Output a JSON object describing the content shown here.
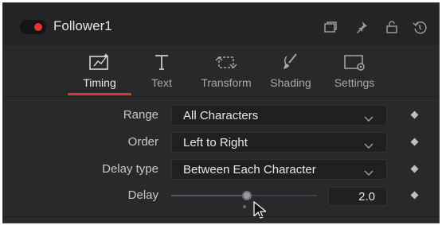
{
  "header": {
    "title": "Follower1",
    "toggle_color": "#e8322f",
    "icons": [
      "window-icon",
      "pin-icon",
      "lock-icon",
      "reset-icon"
    ]
  },
  "tabs": [
    {
      "label": "Timing",
      "icon": "timing-icon",
      "active": true
    },
    {
      "label": "Text",
      "icon": "text-icon",
      "active": false
    },
    {
      "label": "Transform",
      "icon": "transform-icon",
      "active": false
    },
    {
      "label": "Shading",
      "icon": "brush-icon",
      "active": false
    },
    {
      "label": "Settings",
      "icon": "settings-icon",
      "active": false
    }
  ],
  "fields": {
    "range": {
      "label": "Range",
      "value": "All Characters"
    },
    "order": {
      "label": "Order",
      "value": "Left to Right"
    },
    "delay_type": {
      "label": "Delay type",
      "value": "Between Each Character"
    },
    "delay": {
      "label": "Delay",
      "value": "2.0",
      "slider_fraction": 0.53
    }
  },
  "accent_color": "#e0352f"
}
